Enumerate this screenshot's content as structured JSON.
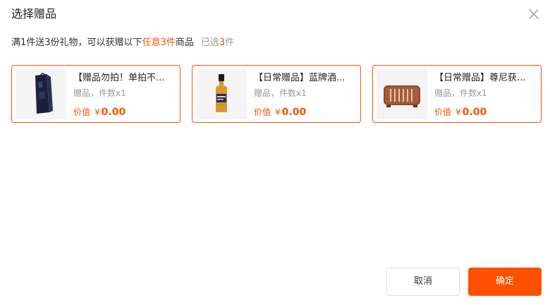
{
  "dialog": {
    "title": "选择赠品",
    "close_icon": "close-icon"
  },
  "rule": {
    "prefix": "满1件送3份礼物，可以获赠以下",
    "highlight": "任意3件",
    "suffix": "商品",
    "selected_prefix": "已选",
    "selected_count": "3",
    "selected_suffix": "件"
  },
  "gifts": [
    {
      "name": "【赠品勿拍！单拍不...",
      "meta": "赠品，件数x1",
      "price_label": "价值",
      "currency": "¥",
      "price": "0.00",
      "image_icon": "gift-bag-image"
    },
    {
      "name": "【日常赠品】蓝牌酒...",
      "meta": "赠品，件数x1",
      "price_label": "价值",
      "currency": "¥",
      "price": "0.00",
      "image_icon": "whisky-bottle-image"
    },
    {
      "name": "【日常赠品】尊尼获...",
      "meta": "赠品，件数x1",
      "price_label": "价值",
      "currency": "¥",
      "price": "0.00",
      "image_icon": "speaker-image"
    }
  ],
  "footer": {
    "cancel_label": "取消",
    "ok_label": "确定"
  },
  "colors": {
    "accent": "#ff5000",
    "border_neutral": "#dddddd",
    "text_muted": "#999999"
  }
}
